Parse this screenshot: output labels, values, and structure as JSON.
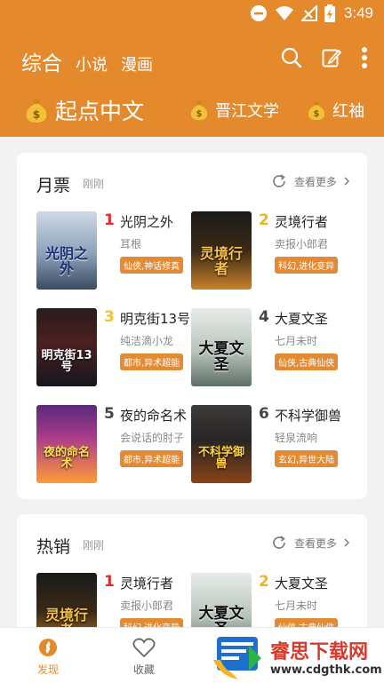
{
  "status_bar": {
    "time": "3:49",
    "icons": [
      "minus-circle-icon",
      "wifi-icon",
      "no-signal-icon",
      "battery-charging-icon"
    ]
  },
  "header": {
    "tabs": [
      "综合",
      "小说",
      "漫画"
    ],
    "actions": [
      "search-icon",
      "edit-icon",
      "more-vert-icon"
    ],
    "sources": [
      "起点中文",
      "晋江文学",
      "红袖"
    ]
  },
  "sections": [
    {
      "title": "月票",
      "time": "刚刚",
      "more_label": "查看更多",
      "books": [
        {
          "rank": "1",
          "title": "光阴之外",
          "author": "耳根",
          "tags": "仙侠,神话修真",
          "cover_text": "光阴之外"
        },
        {
          "rank": "2",
          "title": "灵境行者",
          "author": "卖报小郎君",
          "tags": "科幻,进化变异",
          "cover_text": "灵境行者"
        },
        {
          "rank": "3",
          "title": "明克街13号",
          "author": "纯洁滴小龙",
          "tags": "都市,异术超能",
          "cover_text": "明克街13号"
        },
        {
          "rank": "4",
          "title": "大夏文圣",
          "author": "七月未时",
          "tags": "仙侠,古典仙侠",
          "cover_text": "大夏文圣"
        },
        {
          "rank": "5",
          "title": "夜的命名术",
          "author": "会说话的肘子",
          "tags": "都市,异术超能",
          "cover_text": "夜的命名术"
        },
        {
          "rank": "6",
          "title": "不科学御兽",
          "author": "轻泉流响",
          "tags": "玄幻,异世大陆",
          "cover_text": "不科学御兽"
        }
      ]
    },
    {
      "title": "热销",
      "time": "刚刚",
      "more_label": "查看更多",
      "books": [
        {
          "rank": "1",
          "title": "灵境行者",
          "author": "卖报小郎君",
          "tags": "科幻,进化变异",
          "cover_text": "灵境行者"
        },
        {
          "rank": "2",
          "title": "大夏文圣",
          "author": "七月未时",
          "tags": "仙侠,古典仙侠",
          "cover_text": "大夏文圣"
        }
      ]
    }
  ],
  "bottom_nav": [
    {
      "label": "发现",
      "icon": "discover-icon",
      "active": true
    },
    {
      "label": "收藏",
      "icon": "heart-icon",
      "active": false
    }
  ],
  "watermark": {
    "text": "睿思下载网",
    "url": "www.cdgthk.com"
  },
  "colors": {
    "accent": "#e4892c",
    "tag": "#e38a35",
    "rank1": "#e5292a",
    "rank2": "#e7b42c"
  }
}
